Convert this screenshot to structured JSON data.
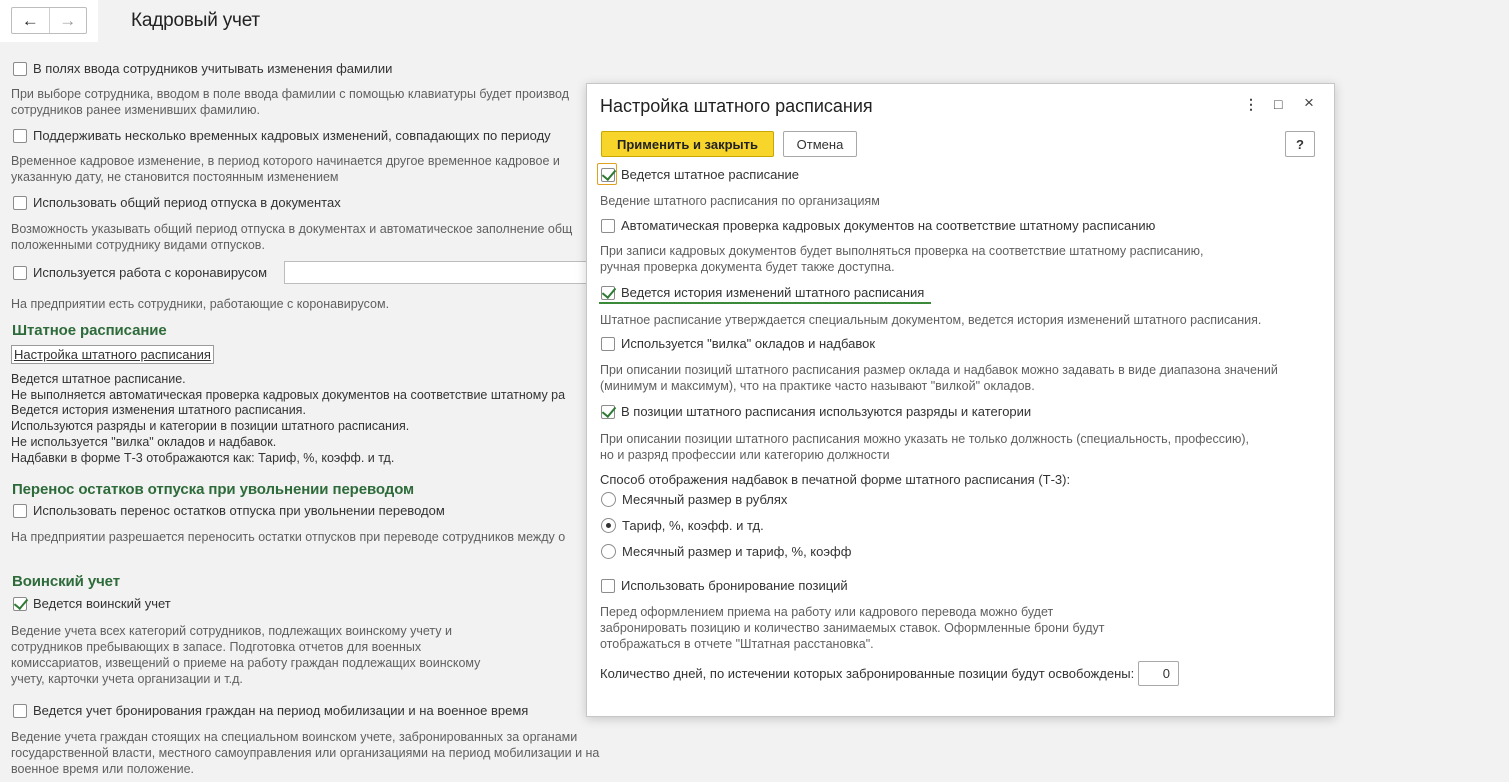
{
  "page": {
    "title": "Кадровый учет",
    "nav_back": "←",
    "nav_forward": "→"
  },
  "background": {
    "surname_changes": {
      "label": "В полях ввода сотрудников учитывать изменения фамилии",
      "checked": false,
      "hint_line1": "При выборе сотрудника, вводом в поле ввода фамилии с помощью клавиатуры будет производ",
      "hint_line2": "сотрудников ранее изменивших фамилию."
    },
    "temp_changes": {
      "label": "Поддерживать несколько временных кадровых изменений, совпадающих по периоду",
      "checked": false,
      "hint_line1": "Временное кадровое изменение, в период которого начинается другое временное кадровое и",
      "hint_line2": "указанную дату, не становится постоянным изменением"
    },
    "vacation_period": {
      "label": "Использовать общий период отпуска в документах",
      "checked": false,
      "hint_line1": "Возможность указывать общий период отпуска в документах и автоматическое заполнение общ",
      "hint_line2": "положенными сотруднику видами отпусков."
    },
    "coronavirus": {
      "label": "Используется работа с коронавирусом",
      "checked": false,
      "hint": "На предприятии есть сотрудники, работающие с коронавирусом."
    },
    "staffing_section": {
      "title": "Штатное расписание",
      "link": "Настройка штатного расписания",
      "lines": [
        "Ведется штатное расписание.",
        "Не выполняется автоматическая проверка кадровых документов на соответствие штатному ра",
        "Ведется история изменения штатного расписания.",
        "Используются разряды и категории в позиции штатного расписания.",
        "Не используется \"вилка\" окладов и надбавок.",
        "Надбавки в форме Т-3 отображаются как: Тариф, %, коэфф. и тд."
      ]
    },
    "transfer_section": {
      "title": "Перенос остатков отпуска при увольнении переводом",
      "label": "Использовать перенос остатков отпуска при увольнении переводом",
      "checked": false,
      "hint": "На предприятии разрешается переносить остатки отпусков при переводе сотрудников между о"
    },
    "military_section": {
      "title": "Воинский учет",
      "label": "Ведется воинский учет",
      "checked": true,
      "hint_lines": [
        "Ведение учета всех категорий сотрудников, подлежащих воинскому учету и",
        "сотрудников пребывающих в запасе. Подготовка отчетов для военных",
        "комиссариатов, извещений о приеме на работу граждан подлежащих воинскому",
        "учету, карточки учета организации и т.д."
      ],
      "reservation_label": "Ведется учет бронирования граждан на период мобилизации и на военное время",
      "reservation_checked": false,
      "reservation_hint_lines": [
        "Ведение учета граждан стоящих на специальном воинском учете, забронированных за органами",
        "государственной власти, местного самоуправления или организациями на период мобилизации и на",
        "военное время или положение."
      ]
    }
  },
  "dialog": {
    "title": "Настройка штатного расписания",
    "menu_icon": "⋮",
    "maximize_icon": "□",
    "close_icon": "×",
    "apply_button": "Применить и закрыть",
    "cancel_button": "Отмена",
    "help_button": "?",
    "options": {
      "staffing": {
        "label": "Ведется штатное расписание",
        "checked": true,
        "hint": "Ведение штатного расписания по организациям"
      },
      "auto_check": {
        "label": "Автоматическая проверка кадровых документов на соответствие штатному расписанию",
        "checked": false,
        "hint_line1": "При записи кадровых документов будет выполняться проверка на соответствие штатному расписанию,",
        "hint_line2": "ручная проверка документа будет также доступна."
      },
      "history": {
        "label": "Ведется история изменений штатного расписания",
        "checked": true,
        "hint": "Штатное расписание утверждается специальным документом, ведется история изменений штатного расписания."
      },
      "fork": {
        "label": "Используется \"вилка\" окладов и надбавок",
        "checked": false,
        "hint_line1": "При описании позиций штатного расписания размер оклада и надбавок можно задавать в виде диапазона значений",
        "hint_line2": "(минимум и максимум), что на практике часто называют \"вилкой\" окладов."
      },
      "grades": {
        "label": "В позиции штатного расписания используются разряды и категории",
        "checked": true,
        "hint_line1": "При описании позиции штатного расписания можно указать не только должность (специальность, профессию),",
        "hint_line2": "но и разряд профессии или категорию должности"
      }
    },
    "display_mode": {
      "label": "Способ отображения надбавок в печатной форме штатного расписания (Т-3):",
      "options": [
        "Месячный размер в рублях",
        "Тариф, %, коэфф. и тд.",
        "Месячный размер и тариф, %, коэфф"
      ],
      "selected": 1
    },
    "booking": {
      "label": "Использовать бронирование позиций",
      "checked": false,
      "hint_lines": [
        "Перед оформлением приема на работу или кадрового перевода можно будет",
        "забронировать позицию и количество занимаемых ставок. Оформленные брони будут",
        "отображаться в отчете \"Штатная расстановка\"."
      ]
    },
    "days": {
      "label": "Количество дней, по истечении которых забронированные позиции будут освобождены:",
      "value": "0"
    }
  },
  "colors": {
    "accent_yellow": "#f7d52a",
    "section_green": "#2e6b3a",
    "check_green": "#2f7a35"
  }
}
